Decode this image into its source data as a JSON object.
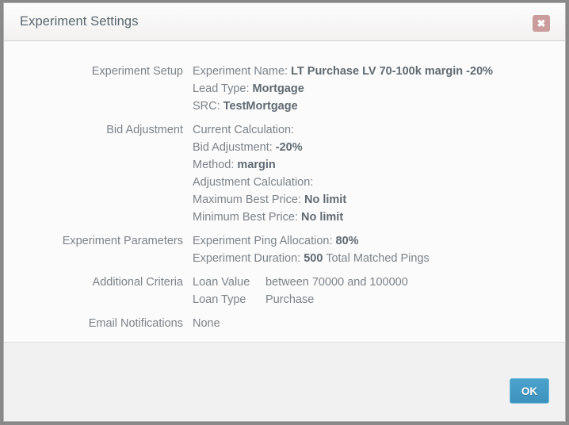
{
  "dialog": {
    "title": "Experiment Settings",
    "close_icon": "close-icon",
    "close_label": "✖"
  },
  "sections": [
    {
      "label": "Experiment Setup",
      "type": "inline",
      "lines": [
        {
          "prefix": "Experiment Name: ",
          "value": "LT Purchase LV 70-100k margin -20%",
          "suffix": ""
        },
        {
          "prefix": "Lead Type: ",
          "value": "Mortgage",
          "suffix": ""
        },
        {
          "prefix": "SRC: ",
          "value": "TestMortgage",
          "suffix": ""
        }
      ]
    },
    {
      "label": "Bid Adjustment",
      "type": "inline",
      "lines": [
        {
          "prefix": "Current Calculation:",
          "value": "",
          "suffix": ""
        },
        {
          "prefix": "Bid Adjustment: ",
          "value": "-20%",
          "suffix": ""
        },
        {
          "prefix": "Method: ",
          "value": "margin",
          "suffix": ""
        },
        {
          "prefix": "Adjustment Calculation:",
          "value": "",
          "suffix": ""
        },
        {
          "prefix": "Maximum Best Price: ",
          "value": "No limit",
          "suffix": ""
        },
        {
          "prefix": "Minimum Best Price: ",
          "value": "No limit",
          "suffix": ""
        }
      ]
    },
    {
      "label": "Experiment Parameters",
      "type": "inline",
      "lines": [
        {
          "prefix": "Experiment Ping Allocation: ",
          "value": "80%",
          "suffix": ""
        },
        {
          "prefix": "Experiment Duration: ",
          "value": "500",
          "suffix": " Total Matched Pings"
        }
      ]
    },
    {
      "label": "Additional Criteria",
      "type": "keyvalue",
      "pairs": [
        {
          "key": "Loan Value",
          "val": "between 70000 and 100000"
        },
        {
          "key": "Loan Type",
          "val": "Purchase"
        }
      ]
    },
    {
      "label": "Email Notifications",
      "type": "plain",
      "lines": [
        {
          "prefix": "None",
          "value": "",
          "suffix": ""
        }
      ]
    }
  ],
  "footer": {
    "ok_label": "OK"
  },
  "colors": {
    "accent": "#3d92bd",
    "close": "#cb9c9c",
    "label_text": "#7b838a",
    "title_text": "#58666e",
    "body_bg": "#fbfbfb",
    "footer_bg": "#f1f1f1"
  }
}
